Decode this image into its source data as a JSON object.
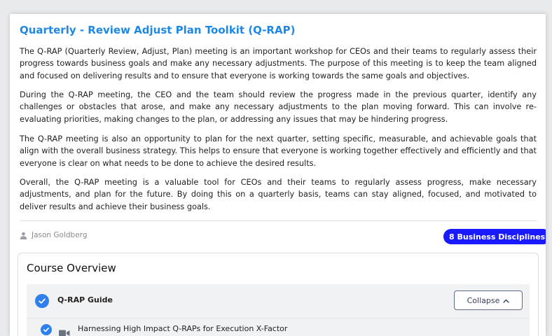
{
  "page": {
    "title": "Quarterly - Review Adjust Plan Toolkit (Q-RAP)",
    "paragraphs": [
      "The Q-RAP (Quarterly Review, Adjust, Plan) meeting is an important workshop for CEOs and their teams to regularly assess their progress towards business goals and make any necessary adjustments. The purpose of this meeting is to keep the team aligned and focused on delivering results and to ensure that everyone is working towards the same goals and objectives.",
      "During the Q-RAP meeting, the CEO and the team should review the progress made in the previous quarter, identify any challenges or obstacles that arose, and make any necessary adjustments to the plan moving forward. This can involve re-evaluating priorities, making changes to the plan, or addressing any issues that may be hindering progress.",
      "The Q-RAP meeting is also an opportunity to plan for the next quarter, setting specific, measurable, and achievable goals that align with the overall business strategy. This helps to ensure that everyone is working together effectively and efficiently and that everyone is clear on what needs to be done to achieve the desired results.",
      "Overall, the Q-RAP meeting is a valuable tool for CEOs and their teams to regularly assess progress, make necessary adjustments, and plan for the future. By doing this on a quarterly basis, teams can stay aligned, focused, and motivated to deliver results and achieve their business goals."
    ]
  },
  "meta": {
    "author": "Jason Goldberg",
    "author_icon": "user-icon",
    "category_badge": "8 Business Disciplines"
  },
  "course_overview": {
    "heading": "Course Overview",
    "section": {
      "label": "Q-RAP Guide",
      "completed": true,
      "collapse_label": "Collapse",
      "collapse_icon": "chevron-up-icon"
    },
    "lessons": [
      {
        "label": "Harnessing High Impact Q-RAPs for Execution X-Factor",
        "icon": "video-icon",
        "completed": true
      }
    ]
  },
  "colors": {
    "title": "#1e88e5",
    "badge": "#1a1aff",
    "check": "#2f80ed"
  }
}
